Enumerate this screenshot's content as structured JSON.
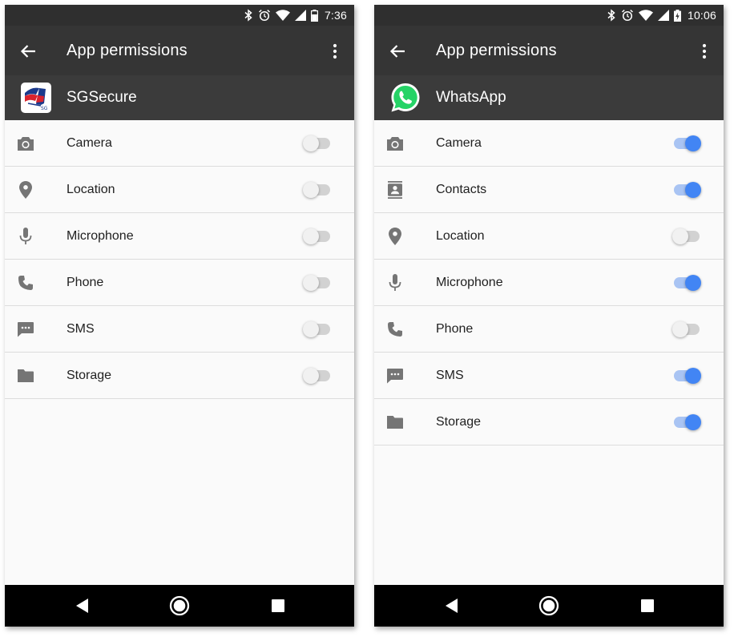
{
  "screens": [
    {
      "status": {
        "time": "7:36",
        "icons": [
          "bluetooth-icon",
          "alarm-icon",
          "wifi-icon",
          "signal-icon",
          "battery-icon"
        ]
      },
      "toolbar": {
        "title": "App permissions",
        "back_icon": "back-arrow-icon",
        "menu_icon": "overflow-menu-icon"
      },
      "app": {
        "name": "SGSecure",
        "icon": "sgsecure-logo"
      },
      "permissions": [
        {
          "label": "Camera",
          "icon": "camera-icon",
          "enabled": false
        },
        {
          "label": "Location",
          "icon": "location-icon",
          "enabled": false
        },
        {
          "label": "Microphone",
          "icon": "microphone-icon",
          "enabled": false
        },
        {
          "label": "Phone",
          "icon": "phone-icon",
          "enabled": false
        },
        {
          "label": "SMS",
          "icon": "sms-icon",
          "enabled": false
        },
        {
          "label": "Storage",
          "icon": "folder-icon",
          "enabled": false
        }
      ]
    },
    {
      "status": {
        "time": "10:06",
        "icons": [
          "bluetooth-icon",
          "alarm-icon",
          "wifi-icon",
          "signal-icon",
          "battery-charging-icon"
        ]
      },
      "toolbar": {
        "title": "App permissions",
        "back_icon": "back-arrow-icon",
        "menu_icon": "overflow-menu-icon"
      },
      "app": {
        "name": "WhatsApp",
        "icon": "whatsapp-logo"
      },
      "permissions": [
        {
          "label": "Camera",
          "icon": "camera-icon",
          "enabled": true
        },
        {
          "label": "Contacts",
          "icon": "contacts-icon",
          "enabled": true
        },
        {
          "label": "Location",
          "icon": "location-icon",
          "enabled": false
        },
        {
          "label": "Microphone",
          "icon": "microphone-icon",
          "enabled": true
        },
        {
          "label": "Phone",
          "icon": "phone-icon",
          "enabled": false
        },
        {
          "label": "SMS",
          "icon": "sms-icon",
          "enabled": true
        },
        {
          "label": "Storage",
          "icon": "folder-icon",
          "enabled": true
        }
      ]
    }
  ],
  "navbar": {
    "icons": [
      "nav-back-icon",
      "nav-home-icon",
      "nav-recents-icon"
    ]
  },
  "colors": {
    "accent": "#4285f4",
    "accent_track": "#a9c4f3",
    "toolbar": "#353535",
    "app_header": "#3b3b3b",
    "status_bar": "#2f2f2f",
    "whatsapp_green": "#25d366"
  }
}
